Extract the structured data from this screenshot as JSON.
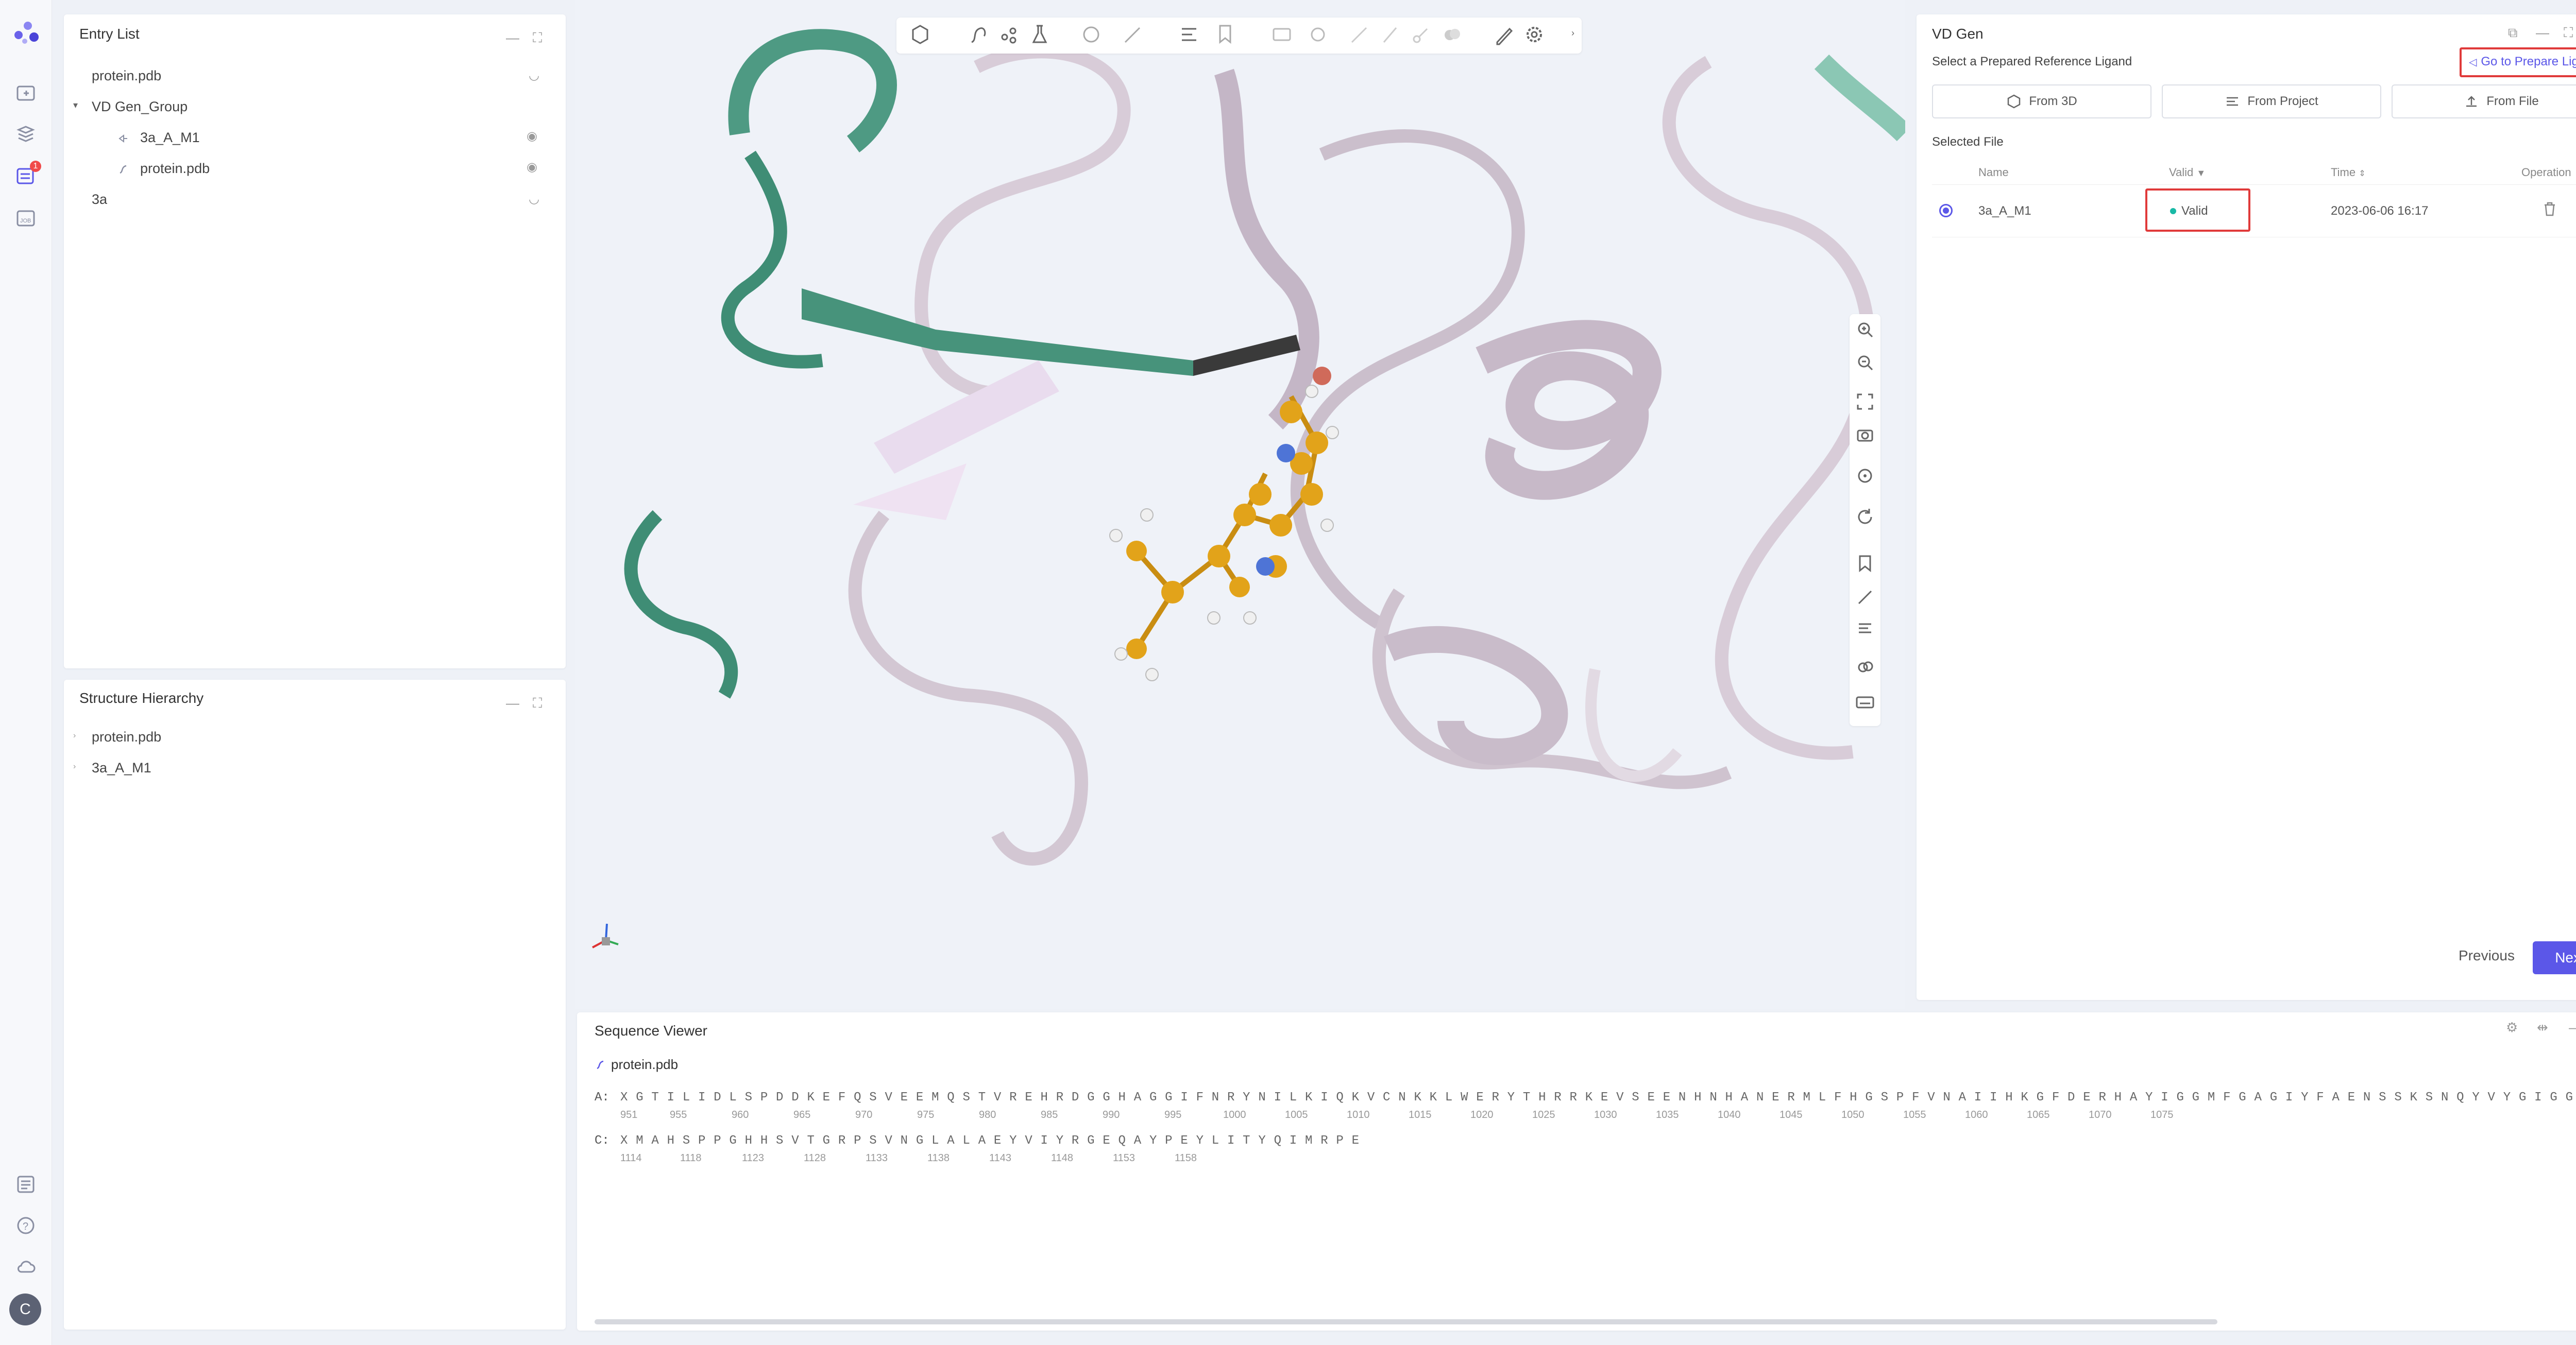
{
  "entry_list": {
    "title": "Entry List",
    "items": [
      {
        "label": "protein.pdb"
      },
      {
        "label": "VD Gen_Group"
      },
      {
        "label": "3a_A_M1"
      },
      {
        "label": "protein.pdb"
      },
      {
        "label": "3a"
      }
    ]
  },
  "structure": {
    "title": "Structure Hierarchy",
    "items": [
      {
        "label": "protein.pdb"
      },
      {
        "label": "3a_A_M1"
      }
    ]
  },
  "rail": {
    "badge": "1",
    "avatar": "C"
  },
  "vdgen": {
    "title": "VD Gen",
    "subtitle": "Select a Prepared Reference Ligand",
    "go_prepare": "Go to Prepare Ligand",
    "from_3d": "From 3D",
    "from_project": "From Project",
    "from_file": "From File",
    "selected_file": "Selected File",
    "columns": {
      "name": "Name",
      "valid": "Valid",
      "time": "Time",
      "operation": "Operation"
    },
    "row": {
      "name": "3a_A_M1",
      "valid": "Valid",
      "time": "2023-06-06 16:17"
    },
    "previous": "Previous",
    "next": "Next",
    "colors": {
      "accent": "#5b57e8",
      "valid_dot": "#18b9a6",
      "highlight": "#e03a3a"
    }
  },
  "sequence": {
    "title": "Sequence Viewer",
    "file": "protein.pdb",
    "chain_a_label": "A:",
    "chain_a": "X G T I L I D L S P D D K E F Q S V E E M Q S T V R E H R D G G H A G G I F N R Y N I L K I Q K V C N K K L W E R Y T H R R K E V S E E N H N H A N E R M L F H G S P F V N A I I H K G F D E R H A Y I G G M F G A G I Y F A E N S S K S N Q Y V Y G I G G G T C",
    "chain_a_numbers": [
      "951",
      "955",
      "960",
      "965",
      "970",
      "975",
      "980",
      "985",
      "990",
      "995",
      "1000",
      "1005",
      "1010",
      "1015",
      "1020",
      "1025",
      "1030",
      "1035",
      "1040",
      "1045",
      "1050",
      "1055",
      "1060",
      "1065",
      "1070",
      "1075"
    ],
    "chain_c_label": "C:",
    "chain_c": "X M A H S P P G H H S V T G R P S V N G L A L A E Y V I Y R G E Q A Y P E Y L I T Y Q I M R P E",
    "chain_c_numbers": [
      "1114",
      "1118",
      "1123",
      "1128",
      "1133",
      "1138",
      "1143",
      "1148",
      "1153",
      "1158"
    ]
  }
}
